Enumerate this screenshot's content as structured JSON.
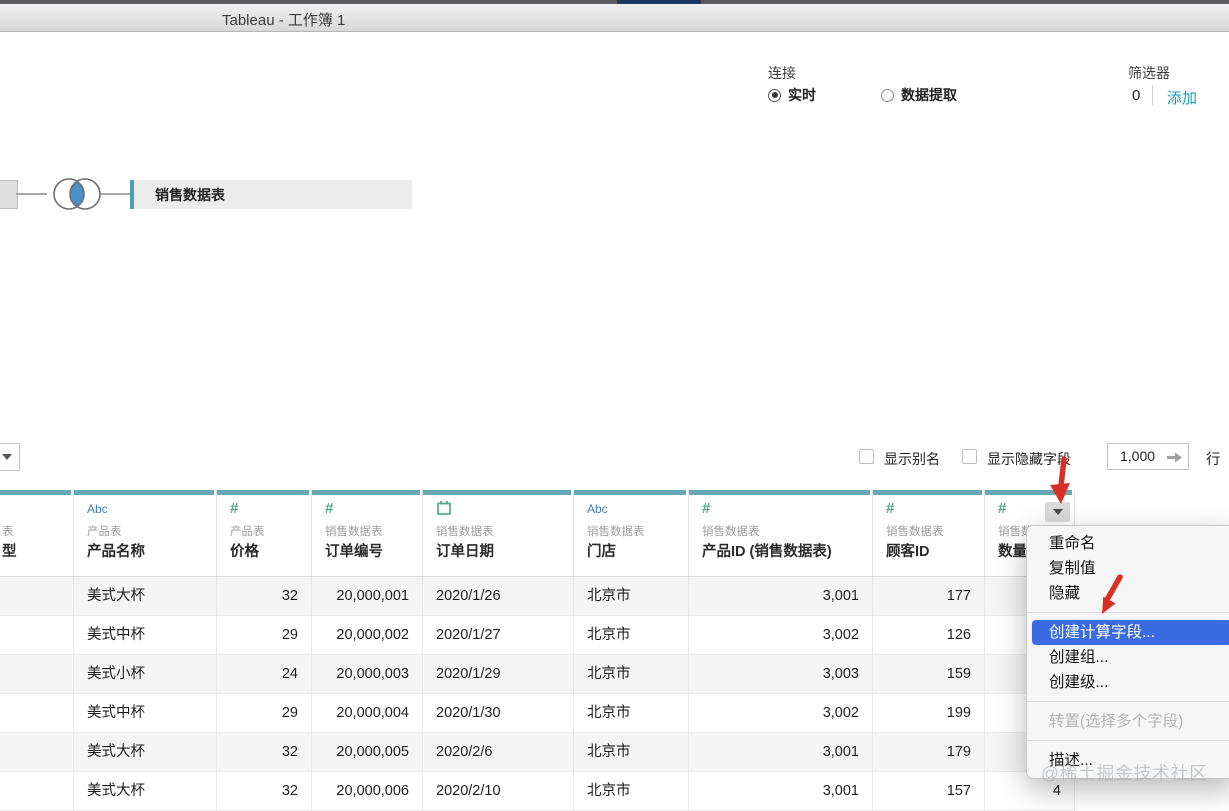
{
  "window": {
    "title": "Tableau - 工作簿 1"
  },
  "connection": {
    "label": "连接",
    "options": [
      {
        "label": "实时",
        "selected": true
      },
      {
        "label": "数据提取",
        "selected": false
      }
    ]
  },
  "filters": {
    "label": "筛选器",
    "count": "0",
    "add_link": "添加"
  },
  "join_canvas": {
    "table_label": "销售数据表",
    "join_type": "inner-join"
  },
  "grid_toolbar": {
    "show_aliases_label": "显示别名",
    "show_aliases_checked": false,
    "show_hidden_label": "显示隐藏字段",
    "show_hidden_checked": false,
    "rows_value": "1,000",
    "rows_unit": "行"
  },
  "grid": {
    "columns": [
      {
        "type": "none",
        "table": "表",
        "field": "型"
      },
      {
        "type": "abc",
        "table": "产品表",
        "field": "产品名称"
      },
      {
        "type": "num",
        "table": "产品表",
        "field": "价格"
      },
      {
        "type": "num",
        "table": "销售数据表",
        "field": "订单编号"
      },
      {
        "type": "date",
        "table": "销售数据表",
        "field": "订单日期"
      },
      {
        "type": "abc",
        "table": "销售数据表",
        "field": "门店"
      },
      {
        "type": "num",
        "table": "销售数据表",
        "field": "产品ID (销售数据表)"
      },
      {
        "type": "num",
        "table": "销售数据表",
        "field": "顾客ID"
      },
      {
        "type": "num",
        "table": "销售数据表",
        "field": "数量"
      }
    ],
    "rows": [
      [
        "",
        "美式大杯",
        "32",
        "20,000,001",
        "2020/1/26",
        "北京市",
        "3,001",
        "177",
        ""
      ],
      [
        "",
        "美式中杯",
        "29",
        "20,000,002",
        "2020/1/27",
        "北京市",
        "3,002",
        "126",
        ""
      ],
      [
        "",
        "美式小杯",
        "24",
        "20,000,003",
        "2020/1/29",
        "北京市",
        "3,003",
        "159",
        ""
      ],
      [
        "",
        "美式中杯",
        "29",
        "20,000,004",
        "2020/1/30",
        "北京市",
        "3,002",
        "199",
        ""
      ],
      [
        "",
        "美式大杯",
        "32",
        "20,000,005",
        "2020/2/6",
        "北京市",
        "3,001",
        "179",
        ""
      ],
      [
        "",
        "美式大杯",
        "32",
        "20,000,006",
        "2020/2/10",
        "北京市",
        "3,001",
        "157",
        "4"
      ]
    ]
  },
  "context_menu": {
    "items": [
      {
        "label": "重命名",
        "state": "normal"
      },
      {
        "label": "复制值",
        "state": "normal"
      },
      {
        "label": "隐藏",
        "state": "normal"
      },
      {
        "type": "separator"
      },
      {
        "label": "创建计算字段...",
        "state": "highlighted"
      },
      {
        "label": "创建组...",
        "state": "normal"
      },
      {
        "label": "创建级...",
        "state": "normal"
      },
      {
        "type": "separator"
      },
      {
        "label": "转置(选择多个字段)",
        "state": "disabled"
      },
      {
        "type": "separator"
      },
      {
        "label": "描述...",
        "state": "normal"
      }
    ]
  },
  "watermark": "@稀土掘金技术社区",
  "colors": {
    "accent_teal": "#68a7b6",
    "dimension_blue": "#3d7fb5",
    "measure_green": "#4fa88c",
    "link_teal": "#1ba0b0",
    "menu_highlight_blue": "#3b6be2",
    "annotation_red": "#d93025",
    "join_fill_blue": "#4a90c8"
  }
}
